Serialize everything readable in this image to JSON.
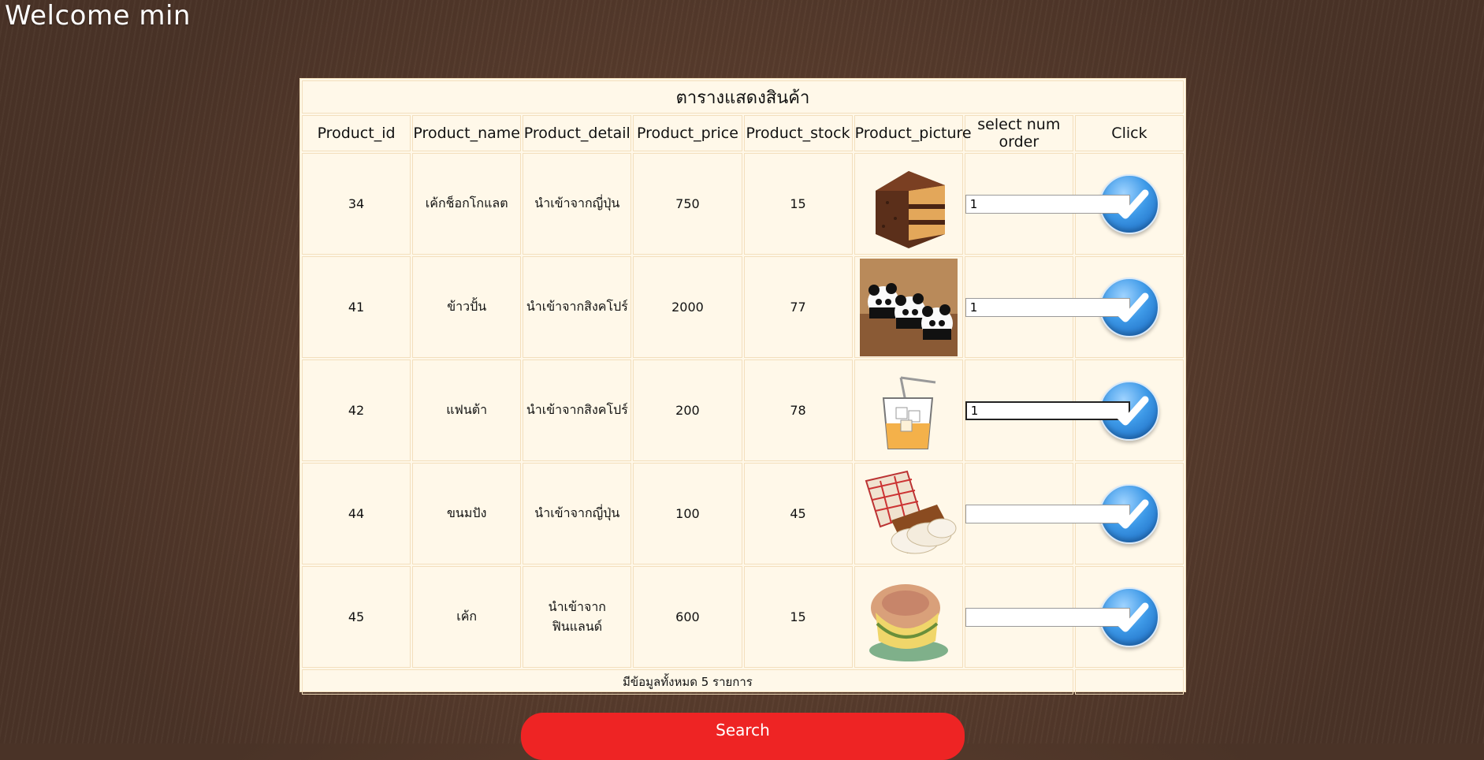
{
  "header": {
    "welcome": "Welcome min"
  },
  "table": {
    "caption": "ตารางแสดงสินค้า",
    "columns": [
      "Product_id",
      "Product_name",
      "Product_detail",
      "Product_price",
      "Product_stock",
      "Product_picture",
      "select num order",
      "Click"
    ],
    "rows": [
      {
        "id": "34",
        "name": "เค้กช็อกโกแลต",
        "detail": "นำเข้าจากญี่ปุ่น",
        "price": "750",
        "stock": "15",
        "picture": "chocolate-cake",
        "qty": "1"
      },
      {
        "id": "41",
        "name": "ข้าวปั้น",
        "detail": "นำเข้าจากสิงคโปร์",
        "price": "2000",
        "stock": "77",
        "picture": "panda-rice-balls",
        "qty": "1"
      },
      {
        "id": "42",
        "name": "แฟนต้า",
        "detail": "นำเข้าจากสิงคโปร์",
        "price": "200",
        "stock": "78",
        "picture": "iced-drink",
        "qty": "1"
      },
      {
        "id": "44",
        "name": "ขนมปัง",
        "detail": "นำเข้าจากญี่ปุ่น",
        "price": "100",
        "stock": "45",
        "picture": "sliced-bread",
        "qty": ""
      },
      {
        "id": "45",
        "name": "เค้ก",
        "detail": "นำเข้าจากฟินแลนด์",
        "price": "600",
        "stock": "15",
        "picture": "layer-cake",
        "qty": ""
      }
    ],
    "footer": "มีข้อมูลทั้งหมด 5 รายการ"
  },
  "search": {
    "label": "Search"
  },
  "colors": {
    "accent_red": "#ee2424",
    "table_bg": "#fff8e9",
    "cell_border": "#f3dfbd"
  }
}
